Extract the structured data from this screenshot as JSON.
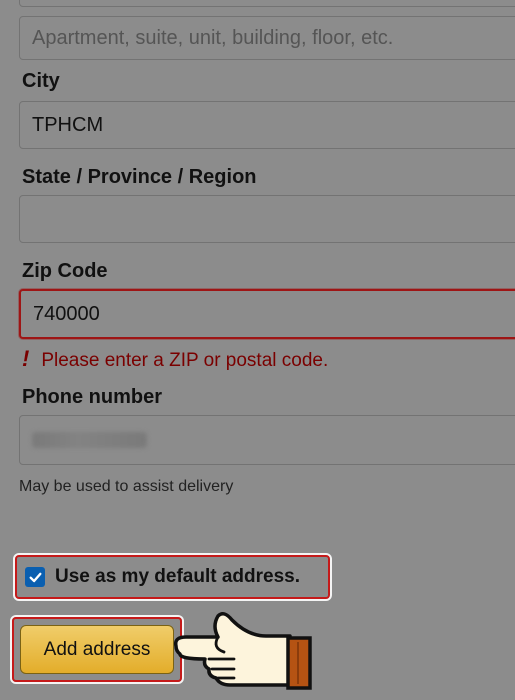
{
  "address_line2": {
    "placeholder": "Apartment, suite, unit, building, floor, etc."
  },
  "city": {
    "label": "City",
    "value": "TPHCM"
  },
  "state": {
    "label": "State / Province / Region",
    "value": ""
  },
  "zip": {
    "label": "Zip Code",
    "value": "740000",
    "error": "Please enter a ZIP or postal code.",
    "error_icon": "!"
  },
  "phone": {
    "label": "Phone number",
    "hint": "May be used to assist delivery"
  },
  "default_address": {
    "label": "Use as my default address.",
    "checked": true
  },
  "submit": {
    "label": "Add address"
  },
  "colors": {
    "background": "#8c8c8c",
    "error": "#7a0000",
    "highlight": "#c51a1a",
    "checkbox": "#0a5fb0",
    "button": "#e3ad2a"
  }
}
